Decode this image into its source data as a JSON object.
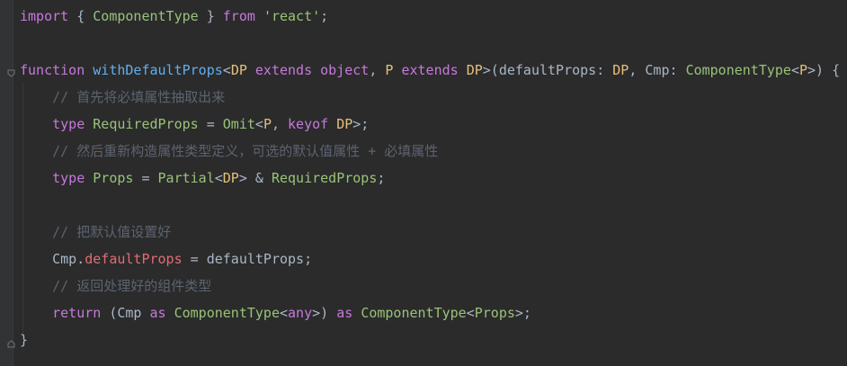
{
  "editor": {
    "language": "typescript",
    "theme": {
      "background": "#2b2b2b",
      "gutter": "#313335",
      "keyword": "#c679dd",
      "function": "#61afef",
      "type_param": "#e5c07b",
      "type_name": "#98c379",
      "string": "#98c379",
      "comment": "#5c6370",
      "property": "#e06c75",
      "plain": "#a9b7c6"
    },
    "icons": {
      "fold_open": "fold-open-icon",
      "fold_close": "fold-close-icon"
    },
    "lines": [
      {
        "tokens": [
          {
            "t": "import",
            "c": "kw"
          },
          {
            "t": " { ",
            "c": "pl"
          },
          {
            "t": "ComponentType",
            "c": "tyg"
          },
          {
            "t": " } ",
            "c": "pl"
          },
          {
            "t": "from",
            "c": "kw"
          },
          {
            "t": " ",
            "c": "pl"
          },
          {
            "t": "'react'",
            "c": "str"
          },
          {
            "t": ";",
            "c": "pl"
          }
        ]
      },
      {
        "tokens": []
      },
      {
        "tokens": [
          {
            "t": "function",
            "c": "kw"
          },
          {
            "t": " ",
            "c": "pl"
          },
          {
            "t": "withDefaultProps",
            "c": "fn"
          },
          {
            "t": "<",
            "c": "pl"
          },
          {
            "t": "DP",
            "c": "ty"
          },
          {
            "t": " ",
            "c": "pl"
          },
          {
            "t": "extends",
            "c": "kw"
          },
          {
            "t": " ",
            "c": "pl"
          },
          {
            "t": "object",
            "c": "kw"
          },
          {
            "t": ", ",
            "c": "pl"
          },
          {
            "t": "P",
            "c": "ty"
          },
          {
            "t": " ",
            "c": "pl"
          },
          {
            "t": "extends",
            "c": "kw"
          },
          {
            "t": " ",
            "c": "pl"
          },
          {
            "t": "DP",
            "c": "ty"
          },
          {
            "t": ">(defaultProps: ",
            "c": "pl"
          },
          {
            "t": "DP",
            "c": "ty"
          },
          {
            "t": ", Cmp: ",
            "c": "pl"
          },
          {
            "t": "ComponentType",
            "c": "tyg"
          },
          {
            "t": "<",
            "c": "pl"
          },
          {
            "t": "P",
            "c": "ty"
          },
          {
            "t": ">) {",
            "c": "pl"
          }
        ]
      },
      {
        "tokens": [
          {
            "t": "    ",
            "c": "pl"
          },
          {
            "t": "// 首先将必填属性抽取出来",
            "c": "cm"
          }
        ]
      },
      {
        "tokens": [
          {
            "t": "    ",
            "c": "pl"
          },
          {
            "t": "type",
            "c": "kw"
          },
          {
            "t": " ",
            "c": "pl"
          },
          {
            "t": "RequiredProps",
            "c": "tyg"
          },
          {
            "t": " = ",
            "c": "pl"
          },
          {
            "t": "Omit",
            "c": "tyg"
          },
          {
            "t": "<",
            "c": "pl"
          },
          {
            "t": "P",
            "c": "ty"
          },
          {
            "t": ", ",
            "c": "pl"
          },
          {
            "t": "keyof",
            "c": "kw"
          },
          {
            "t": " ",
            "c": "pl"
          },
          {
            "t": "DP",
            "c": "ty"
          },
          {
            "t": ">;",
            "c": "pl"
          }
        ]
      },
      {
        "tokens": [
          {
            "t": "    ",
            "c": "pl"
          },
          {
            "t": "// 然后重新构造属性类型定义，可选的默认值属性 + 必填属性",
            "c": "cm"
          }
        ]
      },
      {
        "tokens": [
          {
            "t": "    ",
            "c": "pl"
          },
          {
            "t": "type",
            "c": "kw"
          },
          {
            "t": " ",
            "c": "pl"
          },
          {
            "t": "Props",
            "c": "tyg"
          },
          {
            "t": " = ",
            "c": "pl"
          },
          {
            "t": "Partial",
            "c": "tyg"
          },
          {
            "t": "<",
            "c": "pl"
          },
          {
            "t": "DP",
            "c": "ty"
          },
          {
            "t": "> & ",
            "c": "pl"
          },
          {
            "t": "RequiredProps",
            "c": "tyg"
          },
          {
            "t": ";",
            "c": "pl"
          }
        ]
      },
      {
        "tokens": []
      },
      {
        "tokens": [
          {
            "t": "    ",
            "c": "pl"
          },
          {
            "t": "// 把默认值设置好",
            "c": "cm"
          }
        ]
      },
      {
        "tokens": [
          {
            "t": "    Cmp.",
            "c": "pl"
          },
          {
            "t": "defaultProps",
            "c": "prop"
          },
          {
            "t": " = defaultProps;",
            "c": "pl"
          }
        ]
      },
      {
        "tokens": [
          {
            "t": "    ",
            "c": "pl"
          },
          {
            "t": "// 返回处理好的组件类型",
            "c": "cm"
          }
        ]
      },
      {
        "tokens": [
          {
            "t": "    ",
            "c": "pl"
          },
          {
            "t": "return",
            "c": "kw"
          },
          {
            "t": " (Cmp ",
            "c": "pl"
          },
          {
            "t": "as",
            "c": "kw"
          },
          {
            "t": " ",
            "c": "pl"
          },
          {
            "t": "ComponentType",
            "c": "tyg"
          },
          {
            "t": "<",
            "c": "pl"
          },
          {
            "t": "any",
            "c": "kw"
          },
          {
            "t": ">) ",
            "c": "pl"
          },
          {
            "t": "as",
            "c": "kw"
          },
          {
            "t": " ",
            "c": "pl"
          },
          {
            "t": "ComponentType",
            "c": "tyg"
          },
          {
            "t": "<",
            "c": "pl"
          },
          {
            "t": "Props",
            "c": "tyg"
          },
          {
            "t": ">;",
            "c": "pl"
          }
        ]
      },
      {
        "tokens": [
          {
            "t": "}",
            "c": "pl"
          }
        ]
      }
    ]
  }
}
